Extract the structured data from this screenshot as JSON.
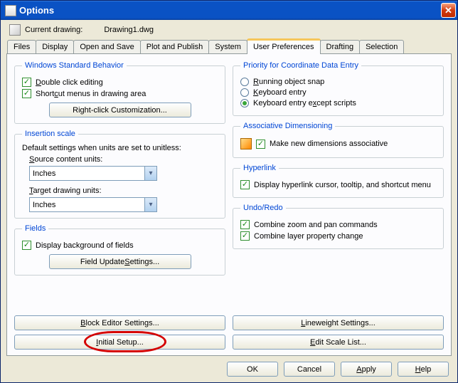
{
  "window": {
    "title": "Options"
  },
  "current_drawing": {
    "label": "Current drawing:",
    "value": "Drawing1.dwg"
  },
  "tabs": [
    "Files",
    "Display",
    "Open and Save",
    "Plot and Publish",
    "System",
    "User Preferences",
    "Drafting",
    "Selection"
  ],
  "active_tab": "User Preferences",
  "wsb": {
    "legend": "Windows Standard Behavior",
    "double_click": "Double click editing",
    "shortcut_menus": "Shortcut menus in drawing area",
    "right_click_btn": "Right-click Customization..."
  },
  "insertion": {
    "legend": "Insertion scale",
    "default_label": "Default settings when units are set to unitless:",
    "source_label": "Source content units:",
    "source_value": "Inches",
    "target_label": "Target drawing units:",
    "target_value": "Inches"
  },
  "fields": {
    "legend": "Fields",
    "display_bg": "Display background of fields",
    "update_btn": "Field Update Settings..."
  },
  "priority": {
    "legend": "Priority for Coordinate Data Entry",
    "running": "Running object snap",
    "keyboard": "Keyboard entry",
    "kb_except": "Keyboard entry except scripts"
  },
  "assoc": {
    "legend": "Associative Dimensioning",
    "make_new": "Make new dimensions associative"
  },
  "hyperlink": {
    "legend": "Hyperlink",
    "display": "Display hyperlink cursor, tooltip, and shortcut menu"
  },
  "undo": {
    "legend": "Undo/Redo",
    "combine_zoom": "Combine zoom and pan commands",
    "combine_layer": "Combine layer property change"
  },
  "bottom": {
    "block_editor": "Block Editor Settings...",
    "initial_setup": "Initial Setup...",
    "lineweight": "Lineweight Settings...",
    "edit_scale": "Edit Scale List..."
  },
  "dialog": {
    "ok": "OK",
    "cancel": "Cancel",
    "apply": "Apply",
    "help": "Help"
  }
}
